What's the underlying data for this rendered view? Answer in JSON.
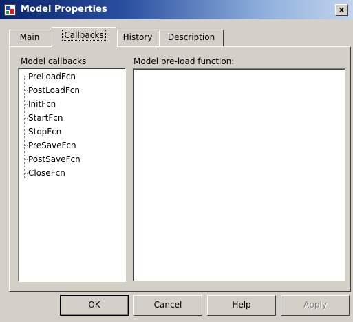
{
  "window": {
    "title": "Model Properties",
    "close_label": "x"
  },
  "tabs": [
    {
      "label": "Main",
      "active": false
    },
    {
      "label": "Callbacks",
      "active": true
    },
    {
      "label": "History",
      "active": false
    },
    {
      "label": "Description",
      "active": false
    }
  ],
  "callbacks": {
    "tree_header": "Model callbacks",
    "items": [
      "PreLoadFcn",
      "PostLoadFcn",
      "InitFcn",
      "StartFcn",
      "StopFcn",
      "PreSaveFcn",
      "PostSaveFcn",
      "CloseFcn"
    ],
    "function_label": "Model pre-load function:",
    "function_value": ""
  },
  "buttons": {
    "ok": "OK",
    "cancel": "Cancel",
    "help": "Help",
    "apply": "Apply"
  },
  "icons": {
    "app": "model-properties-icon",
    "close": "close-icon"
  }
}
